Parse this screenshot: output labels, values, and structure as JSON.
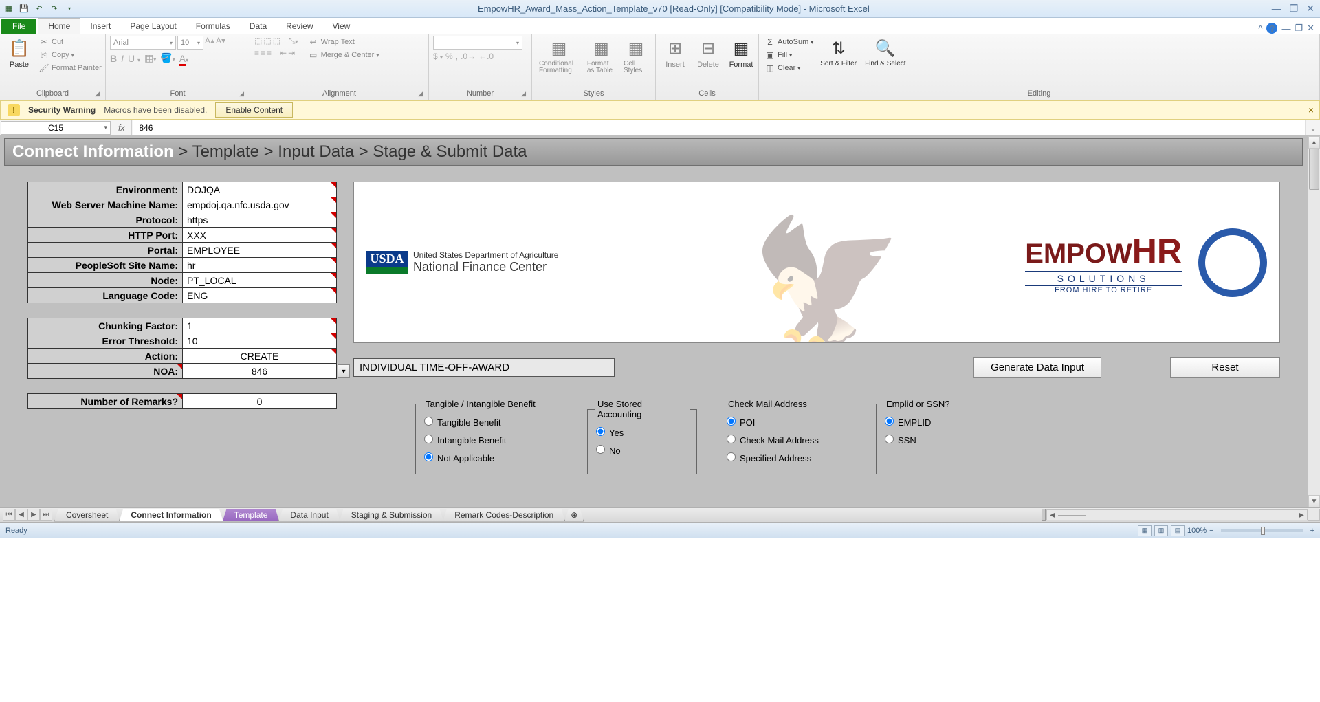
{
  "titlebar": {
    "title": "EmpowHR_Award_Mass_Action_Template_v70  [Read-Only]  [Compatibility Mode] - Microsoft Excel"
  },
  "ribbon": {
    "file": "File",
    "tabs": [
      "Home",
      "Insert",
      "Page Layout",
      "Formulas",
      "Data",
      "Review",
      "View"
    ],
    "active_tab": "Home",
    "clipboard": {
      "paste": "Paste",
      "cut": "Cut",
      "copy": "Copy",
      "fp": "Format Painter",
      "label": "Clipboard"
    },
    "font": {
      "name": "Arial",
      "size": "10",
      "label": "Font"
    },
    "alignment": {
      "wrap": "Wrap Text",
      "merge": "Merge & Center",
      "label": "Alignment"
    },
    "number": {
      "label": "Number"
    },
    "styles": {
      "cf": "Conditional Formatting",
      "fat": "Format as Table",
      "cs": "Cell Styles",
      "label": "Styles"
    },
    "cells": {
      "insert": "Insert",
      "delete": "Delete",
      "format": "Format",
      "label": "Cells"
    },
    "editing": {
      "autosum": "AutoSum",
      "fill": "Fill",
      "clear": "Clear",
      "sort": "Sort & Filter",
      "find": "Find & Select",
      "label": "Editing"
    }
  },
  "security": {
    "title": "Security Warning",
    "msg": "Macros have been disabled.",
    "btn": "Enable Content"
  },
  "formula": {
    "cell": "C15",
    "fx": "fx",
    "value": "846"
  },
  "breadcrumb": {
    "a": "Connect Information",
    "b": " > Template  > Input Data  > Stage & Submit Data"
  },
  "form": {
    "env_l": "Environment:",
    "env_v": "DOJQA",
    "wsm_l": "Web Server Machine Name:",
    "wsm_v": "empdoj.qa.nfc.usda.gov",
    "proto_l": "Protocol:",
    "proto_v": "https",
    "port_l": "HTTP Port:",
    "port_v": "XXX",
    "portal_l": "Portal:",
    "portal_v": "EMPLOYEE",
    "pssn_l": "PeopleSoft Site Name:",
    "pssn_v": "hr",
    "node_l": "Node:",
    "node_v": "PT_LOCAL",
    "lang_l": "Language Code:",
    "lang_v": "ENG",
    "chunk_l": "Chunking Factor:",
    "chunk_v": "1",
    "err_l": "Error Threshold:",
    "err_v": "10",
    "action_l": "Action:",
    "action_v": "CREATE",
    "noa_l": "NOA:",
    "noa_v": "846",
    "rem_l": "Number of Remarks?",
    "rem_v": "0"
  },
  "banner": {
    "usda": "USDA",
    "dept": "United States Department of Agriculture",
    "nfc": "National Finance Center",
    "empow": "EMPOW",
    "hr": "HR",
    "sol": "SOLUTIONS",
    "tag": "FROM HIRE TO RETIRE"
  },
  "award": "INDIVIDUAL TIME-OFF-AWARD",
  "buttons": {
    "gen": "Generate Data Input",
    "reset": "Reset"
  },
  "groups": {
    "benefit": {
      "legend": "Tangible / Intangible Benefit",
      "o1": "Tangible Benefit",
      "o2": "Intangible Benefit",
      "o3": "Not Applicable"
    },
    "stored": {
      "legend": "Use Stored Accounting",
      "o1": "Yes",
      "o2": "No"
    },
    "mail": {
      "legend": "Check Mail Address",
      "o1": "POI",
      "o2": "Check Mail Address",
      "o3": "Specified Address"
    },
    "emp": {
      "legend": "Emplid or SSN?",
      "o1": "EMPLID",
      "o2": "SSN"
    }
  },
  "sheets": [
    "Coversheet",
    "Connect Information",
    "Template",
    "Data Input",
    "Staging & Submission",
    "Remark Codes-Description"
  ],
  "status": {
    "ready": "Ready",
    "zoom": "100%"
  },
  "currency": "$",
  "percent": "%"
}
